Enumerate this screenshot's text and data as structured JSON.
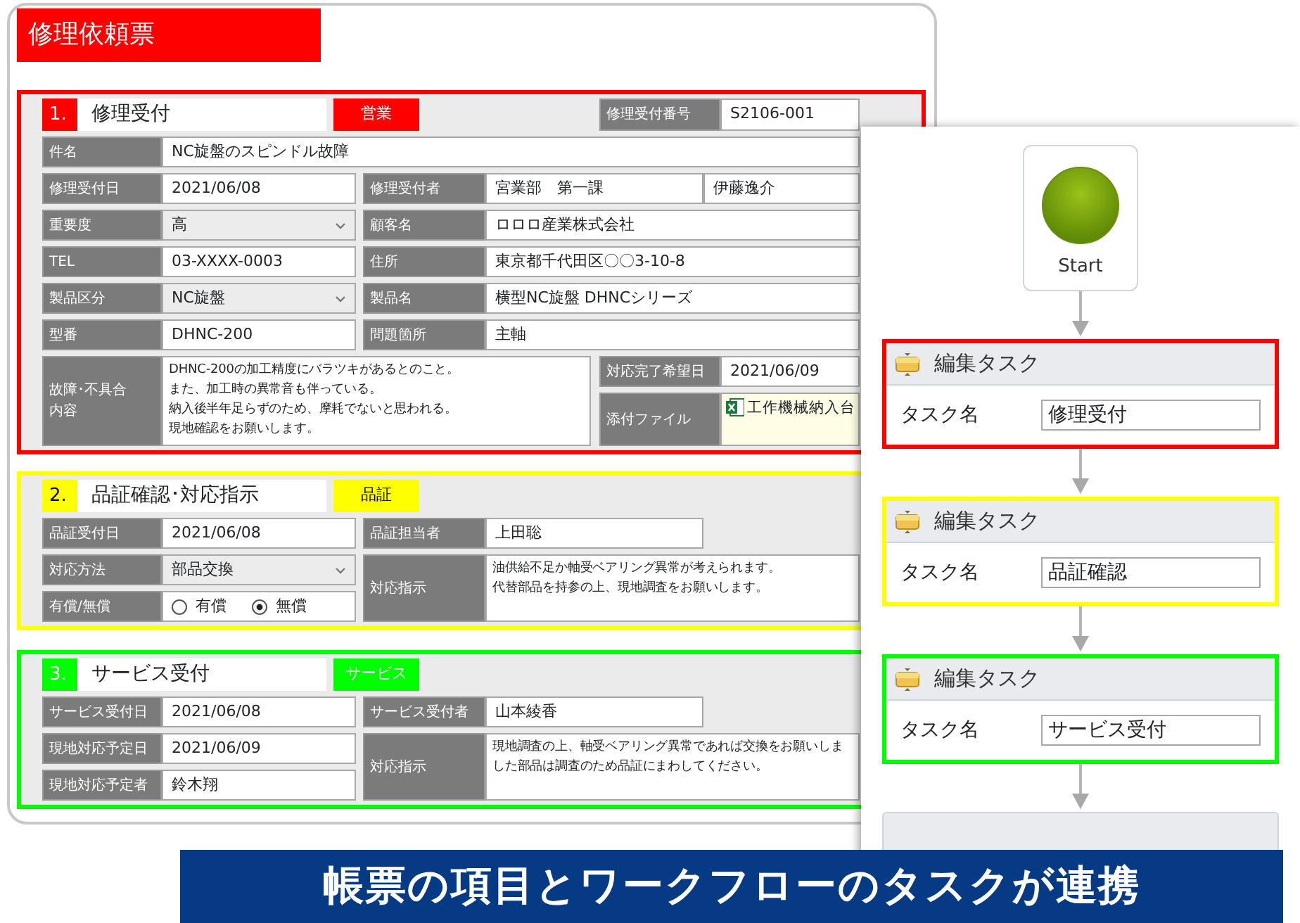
{
  "form": {
    "title": "修理依頼票",
    "sections": [
      {
        "number": "1.",
        "title": "修理受付",
        "tag": "営業",
        "color": "#ff0000",
        "fields": [
          {
            "kind": "text",
            "label": "修理受付番号",
            "value": "S2106-001"
          },
          {
            "kind": "text",
            "label": "件名",
            "value": "NC旋盤のスピンドル故障"
          },
          {
            "kind": "text",
            "label": "修理受付日",
            "value": "2021/06/08"
          },
          {
            "kind": "pair",
            "label": "修理受付者",
            "values": [
              "宮業部　第一課",
              "伊藤逸介"
            ]
          },
          {
            "kind": "select",
            "label": "重要度",
            "value": "高"
          },
          {
            "kind": "text",
            "label": "顧客名",
            "value": "ロロロ産業株式会社"
          },
          {
            "kind": "text",
            "label": "TEL",
            "value": "03-XXXX-0003"
          },
          {
            "kind": "text",
            "label": "住所",
            "value": "東京都千代田区〇〇3-10-8"
          },
          {
            "kind": "select",
            "label": "製品区分",
            "value": "NC旋盤"
          },
          {
            "kind": "text",
            "label": "製品名",
            "value": "横型NC旋盤 DHNCシリーズ"
          },
          {
            "kind": "text",
            "label": "型番",
            "value": "DHNC-200"
          },
          {
            "kind": "text",
            "label": "問題箇所",
            "value": "主軸"
          },
          {
            "kind": "multiline",
            "label_lines": [
              "故障･不具合",
              "内容"
            ],
            "lines": [
              "DHNC-200の加工精度にバラツキがあるとのこと。",
              "また、加工時の異常音も伴っている。",
              "納入後半年足らずのため、摩耗でないと思われる。",
              "現地確認をお願いします。"
            ]
          },
          {
            "kind": "text",
            "label": "対応完了希望日",
            "value": "2021/06/09"
          },
          {
            "kind": "file",
            "label": "添付ファイル",
            "value": "工作機械納入台"
          }
        ]
      },
      {
        "number": "2.",
        "title": "品証確認･対応指示",
        "tag": "品証",
        "color": "#ffff00",
        "fields": [
          {
            "kind": "text",
            "label": "品証受付日",
            "value": "2021/06/08"
          },
          {
            "kind": "select",
            "label": "対応方法",
            "value": "部品交換"
          },
          {
            "kind": "radio",
            "label": "有償/無償",
            "options": [
              {
                "label": "有償",
                "selected": false
              },
              {
                "label": "無償",
                "selected": true
              }
            ]
          },
          {
            "kind": "text",
            "label": "品証担当者",
            "value": "上田聡"
          },
          {
            "kind": "multiline",
            "label_lines": [
              "対応指示"
            ],
            "lines": [
              "油供給不足か軸受ベアリング異常が考えられます。",
              "代替部品を持参の上、現地調査をお願いします。"
            ]
          }
        ]
      },
      {
        "number": "3.",
        "title": "サービス受付",
        "tag": "サービス",
        "color": "#00ff00",
        "fields": [
          {
            "kind": "text",
            "label": "サービス受付日",
            "value": "2021/06/08"
          },
          {
            "kind": "text",
            "label": "現地対応予定日",
            "value": "2021/06/09"
          },
          {
            "kind": "text",
            "label": "現地対応予定者",
            "value": "鈴木翔"
          },
          {
            "kind": "text",
            "label": "サービス受付者",
            "value": "山本綾香"
          },
          {
            "kind": "multiline",
            "label_lines": [
              "対応指示"
            ],
            "lines": [
              "現地調査の上、軸受ベアリング異常であれば交換をお願いしま",
              "した部品は調査のため品証にまわしてください。"
            ]
          }
        ]
      }
    ]
  },
  "workflow": {
    "start": "Start",
    "tasks": [
      {
        "header": "編集タスク",
        "label": "タスク名",
        "value": "修理受付",
        "color": "#ff0000"
      },
      {
        "header": "編集タスク",
        "label": "タスク名",
        "value": "品証確認",
        "color": "#ffff00"
      },
      {
        "header": "編集タスク",
        "label": "タスク名",
        "value": "サービス受付",
        "color": "#00ff00"
      }
    ]
  },
  "banner": "帳票の項目とワークフローのタスクが連携"
}
